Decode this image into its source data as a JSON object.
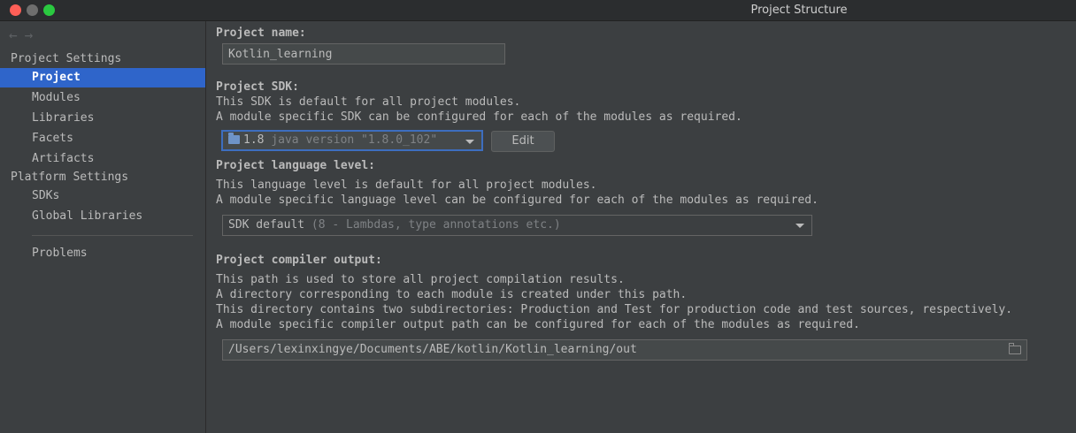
{
  "window": {
    "title": "Project Structure"
  },
  "nav": {
    "back_arrow": "←",
    "forward_arrow": "→",
    "project_settings_label": "Project Settings",
    "project_settings_items": [
      "Project",
      "Modules",
      "Libraries",
      "Facets",
      "Artifacts"
    ],
    "platform_settings_label": "Platform Settings",
    "platform_settings_items": [
      "SDKs",
      "Global Libraries"
    ],
    "problems_label": "Problems",
    "selected": "Project"
  },
  "project_name": {
    "label": "Project name:",
    "value": "Kotlin_learning"
  },
  "project_sdk": {
    "label": "Project SDK:",
    "desc_line1": "This SDK is default for all project modules.",
    "desc_line2": "A module specific SDK can be configured for each of the modules as required.",
    "selected_name": "1.8",
    "selected_detail": "java version \"1.8.0_102\"",
    "edit_label": "Edit"
  },
  "language_level": {
    "label": "Project language level:",
    "desc_line1": "This language level is default for all project modules.",
    "desc_line2": "A module specific language level can be configured for each of the modules as required.",
    "selected_name": "SDK default",
    "selected_detail": "(8 - Lambdas, type annotations etc.)"
  },
  "compiler_output": {
    "label": "Project compiler output:",
    "desc_line1": "This path is used to store all project compilation results.",
    "desc_line2": "A directory corresponding to each module is created under this path.",
    "desc_line3": "This directory contains two subdirectories: Production and Test for production code and test sources, respectively.",
    "desc_line4": "A module specific compiler output path can be configured for each of the modules as required.",
    "path": "/Users/lexinxingye/Documents/ABE/kotlin/Kotlin_learning/out"
  },
  "colors": {
    "background": "#3c3f41",
    "selection": "#2f65ca",
    "focus_border": "#3d6ebf"
  }
}
